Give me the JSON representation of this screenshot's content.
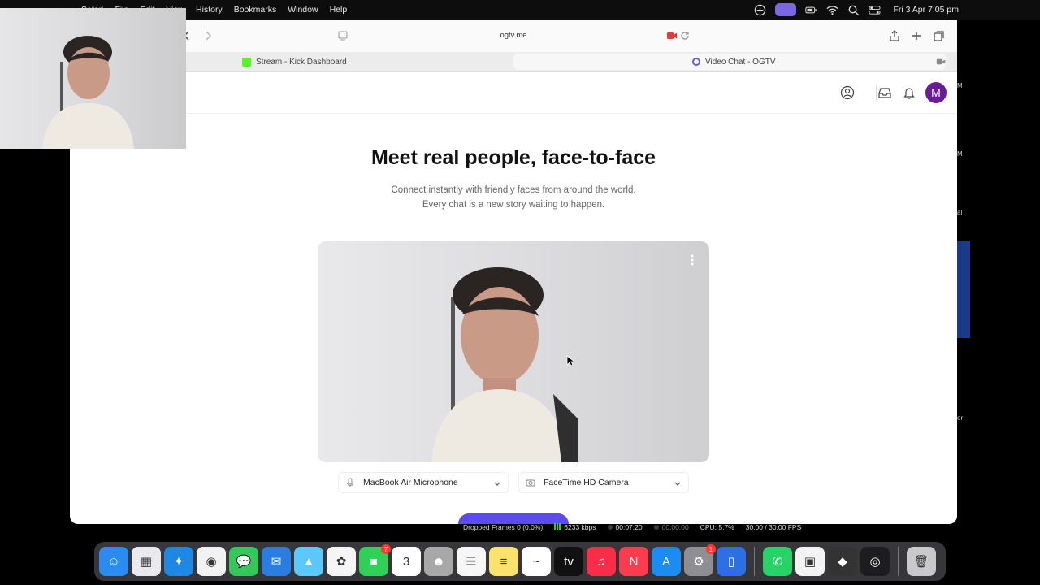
{
  "menubar": {
    "items": [
      "Safari",
      "File",
      "Edit",
      "View",
      "History",
      "Bookmarks",
      "Window",
      "Help"
    ],
    "clock": "Fri 3 Apr  7:05 pm",
    "icons": [
      "accessibility-icon",
      "screen-share-icon",
      "battery-icon",
      "wifi-icon",
      "search-icon",
      "control-center-icon"
    ]
  },
  "browser": {
    "url": "ogtv.me",
    "tabs": [
      {
        "label": "Stream - Kick Dashboard",
        "icon": "kick-icon"
      },
      {
        "label": "Video Chat - OGTV",
        "icon": "ogtv-icon"
      }
    ]
  },
  "page": {
    "avatar_initial": "M",
    "hero_title": "Meet real people, face-to-face",
    "hero_line1": "Connect instantly with friendly faces from around the world.",
    "hero_line2": "Every chat is a new story waiting to happen.",
    "microphone_select": "MacBook Air Microphone",
    "camera_select": "FaceTime HD Camera"
  },
  "stats": {
    "dropped_frames": "Dropped Frames 0 (0.0%)",
    "bitrate": "6233 kbps",
    "stream_time": "00:07:20",
    "record_time": "00:00:00",
    "cpu": "CPU: 5.7%",
    "fps": "30.00 / 30.00 FPS"
  },
  "dock": {
    "apps": [
      {
        "name": "Finder",
        "color": "#2a8cf0",
        "glyph": "☺"
      },
      {
        "name": "Launchpad",
        "color": "#e9e9ee",
        "glyph": "▦"
      },
      {
        "name": "Safari",
        "color": "#1e88e5",
        "glyph": "✦"
      },
      {
        "name": "Chrome",
        "color": "#f2f2f2",
        "glyph": "◉"
      },
      {
        "name": "Messages",
        "color": "#34c759",
        "glyph": "💬"
      },
      {
        "name": "Mail",
        "color": "#2a7de1",
        "glyph": "✉"
      },
      {
        "name": "Maps",
        "color": "#5ac8fa",
        "glyph": "▲"
      },
      {
        "name": "Photos",
        "color": "#f5f5f5",
        "glyph": "✿"
      },
      {
        "name": "FaceTime",
        "color": "#30d158",
        "glyph": "■",
        "badge": "7"
      },
      {
        "name": "Calendar",
        "color": "#ffffff",
        "glyph": "3"
      },
      {
        "name": "Contacts",
        "color": "#a8a8a8",
        "glyph": "☻"
      },
      {
        "name": "Reminders",
        "color": "#f7f7f7",
        "glyph": "☰"
      },
      {
        "name": "Notes",
        "color": "#fbe36b",
        "glyph": "≡"
      },
      {
        "name": "Freeform",
        "color": "#ffffff",
        "glyph": "~"
      },
      {
        "name": "Apple TV",
        "color": "#111111",
        "glyph": "tv"
      },
      {
        "name": "Music",
        "color": "#fa2d48",
        "glyph": "♫"
      },
      {
        "name": "News",
        "color": "#ff3b4f",
        "glyph": "N"
      },
      {
        "name": "App Store",
        "color": "#1c8cf2",
        "glyph": "A"
      },
      {
        "name": "System Settings",
        "color": "#8e8e93",
        "glyph": "⚙",
        "badge": "1"
      },
      {
        "name": "iPhone Mirroring",
        "color": "#2f6fe4",
        "glyph": "▯"
      },
      {
        "name": "WhatsApp",
        "color": "#25d366",
        "glyph": "✆"
      },
      {
        "name": "OMT TV",
        "color": "#f3f3f3",
        "glyph": "▣"
      },
      {
        "name": "Racing Game",
        "color": "#333333",
        "glyph": "◆"
      },
      {
        "name": "OBS",
        "color": "#1d1d1f",
        "glyph": "◎"
      },
      {
        "name": "Trash",
        "color": "#c9c9cc",
        "glyph": "🗑"
      }
    ]
  },
  "edge_fragments": [
    "M",
    "M",
    "al",
    "er",
    "er"
  ]
}
